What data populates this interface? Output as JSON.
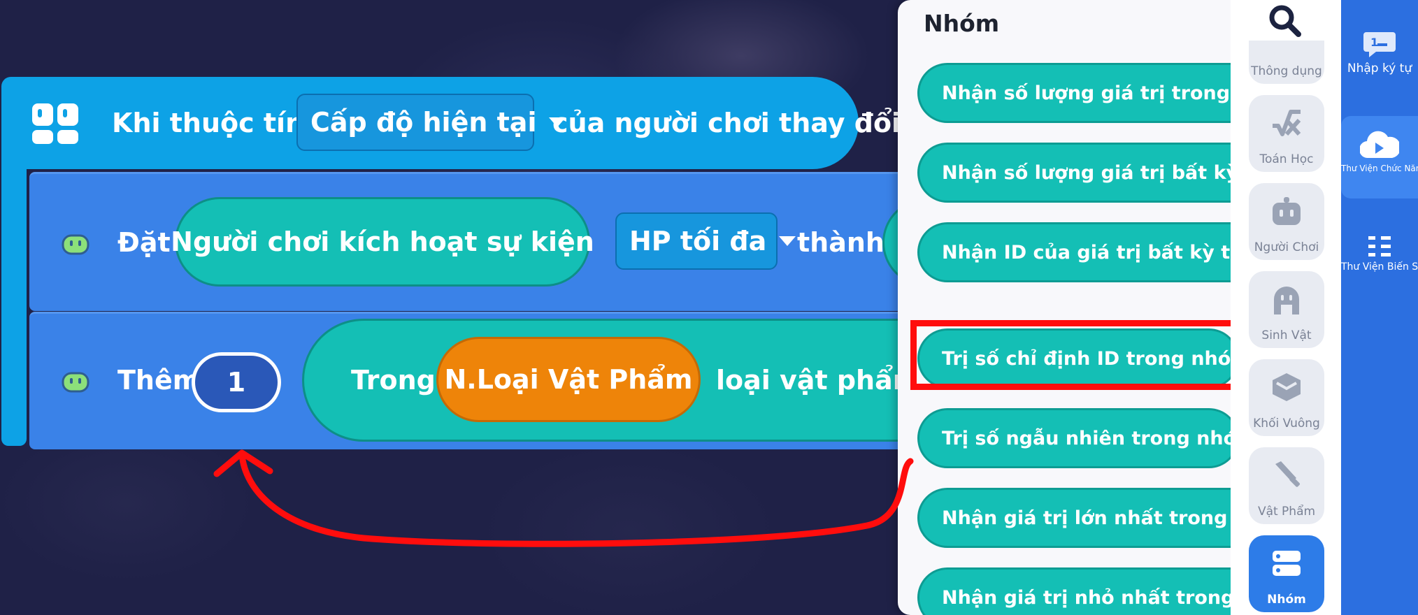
{
  "event_block": {
    "prefix": "Khi thuộc tính",
    "attribute_dropdown": "Cấp độ hiện tại",
    "suffix": "của người chơi thay đổi"
  },
  "set_block": {
    "label": "Đặt",
    "target": "Người chơi kích hoạt sự kiện",
    "property_dropdown": "HP tối đa",
    "to_label": "thành"
  },
  "add_block": {
    "label": "Thêm",
    "amount": "1",
    "in_label": "Trong",
    "group_name": "N.Loại Vật Phẩm",
    "item_label": "loại vật phẩm ID"
  },
  "panel": {
    "title": "Nhóm",
    "items": [
      "Nhận số lượng giá trị trong nhóm bất kỳ",
      "Nhận số lượng giá trị bất kỳ nào trong nhóm",
      "Nhận ID của giá trị bất kỳ trong nhóm",
      "Trị số chỉ định ID trong nhóm trị số",
      "Trị số ngẫu nhiên trong nhóm trị số",
      "Nhận giá trị lớn nhất trong nhóm trị số",
      "Nhận giá trị nhỏ nhất trong nhóm trị số"
    ]
  },
  "categories": [
    {
      "label": "Thông dụng",
      "icon": "list-icon"
    },
    {
      "label": "Toán Học",
      "icon": "math-fx-icon"
    },
    {
      "label": "Người Chơi",
      "icon": "robot-icon"
    },
    {
      "label": "Sinh Vật",
      "icon": "creature-icon"
    },
    {
      "label": "Khối Vuông",
      "icon": "cube-icon"
    },
    {
      "label": "Vật Phẩm",
      "icon": "sword-icon"
    },
    {
      "label": "Nhóm",
      "icon": "group-icon"
    }
  ],
  "rail": [
    {
      "label": "Nhập ký tự",
      "icon": "input-chat-icon"
    },
    {
      "label": "Thư Viện Chức Năng",
      "icon": "function-library-icon"
    },
    {
      "label": "Thư Viện Biến Số",
      "icon": "variable-library-icon"
    }
  ],
  "colors": {
    "background": "#1f2147",
    "event_block": "#0da2e6",
    "action_block": "#3a82e8",
    "teal_pill": "#14bfb5",
    "orange_pill": "#ee8409",
    "highlight": "#ff0d0d",
    "active_category": "#2d7ce8",
    "rail": "#2c6fe0"
  }
}
